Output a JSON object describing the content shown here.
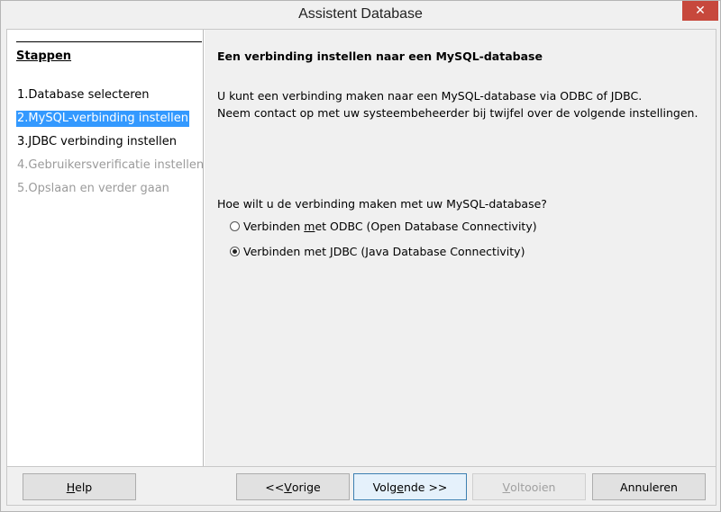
{
  "window": {
    "title": "Assistent Database",
    "close_glyph": "✕"
  },
  "steps": {
    "heading": "Stappen",
    "items": [
      {
        "label": "1.Database selecteren",
        "state": "done"
      },
      {
        "label": "2.MySQL-verbinding instellen",
        "state": "active"
      },
      {
        "label": "3.JDBC verbinding instellen",
        "state": "enabled"
      },
      {
        "label": "4.Gebruikersverificatie instellen",
        "state": "disabled"
      },
      {
        "label": "5.Opslaan en verder gaan",
        "state": "disabled"
      }
    ]
  },
  "page": {
    "title": "Een verbinding instellen naar een MySQL-database",
    "description_lines": [
      "U kunt een verbinding maken naar een MySQL-database via ODBC of JDBC.",
      "Neem contact op met uw systeembeheerder bij twijfel over de volgende instellingen."
    ],
    "question": "Hoe wilt u de verbinding maken met uw MySQL-database?",
    "options": [
      {
        "pre": "Verbinden ",
        "mnemonic": "m",
        "post": "et ODBC (Open Database Connectivity)",
        "checked": false
      },
      {
        "pre": "Verbinden met ",
        "mnemonic": "J",
        "post": "DBC (Java Database Connectivity)",
        "checked": true
      }
    ]
  },
  "buttons": {
    "help": {
      "mnemonic": "H",
      "rest": "elp"
    },
    "back": {
      "pre": "<< ",
      "mnemonic": "V",
      "rest": "orige"
    },
    "next": {
      "pre": "Volg",
      "mnemonic": "e",
      "rest": "nde >>"
    },
    "finish": {
      "mnemonic": "V",
      "rest": "oltooien"
    },
    "cancel": {
      "label": "Annuleren"
    }
  },
  "colors": {
    "selection": "#3399ff",
    "close_button": "#c7483c",
    "disabled_text": "#9b9b9b"
  },
  "icons": {
    "close": "close-icon",
    "radio_unchecked": "radio-unchecked-icon",
    "radio_checked": "radio-checked-icon"
  }
}
